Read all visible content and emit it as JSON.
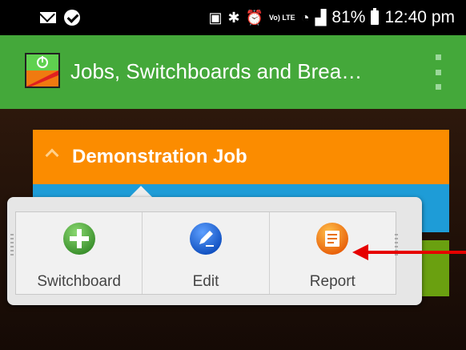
{
  "status_bar": {
    "battery": "81%",
    "time": "12:40 pm",
    "volte_label": "Vo) LTE"
  },
  "app_bar": {
    "title": "Jobs, Switchboards and Brea…"
  },
  "job": {
    "title": "Demonstration Job"
  },
  "popup": {
    "items": [
      {
        "label": "Switchboard",
        "icon": "add-circle-icon",
        "color": "#4aa63c"
      },
      {
        "label": "Edit",
        "icon": "pen-icon",
        "color": "#1a66d6"
      },
      {
        "label": "Report",
        "icon": "report-icon",
        "color": "#f07a10"
      }
    ]
  },
  "colors": {
    "app_bar": "#44a83a",
    "job_row": "#fb8c00",
    "secondary_row": "#1e9cd7",
    "arrow": "#e60000"
  }
}
